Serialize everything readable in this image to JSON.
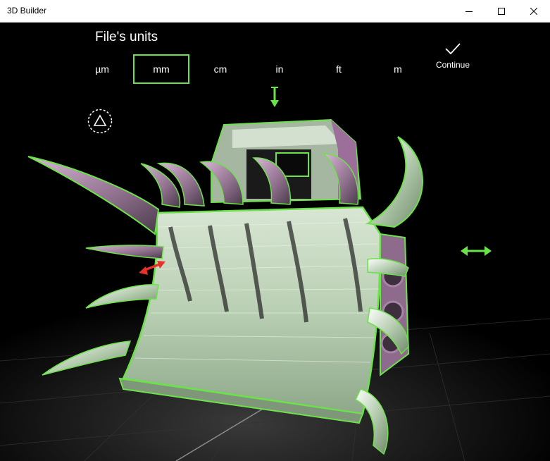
{
  "window": {
    "title": "3D Builder",
    "controls": {
      "minimize": "minimize-icon",
      "maximize": "maximize-icon",
      "close": "close-icon"
    }
  },
  "units_panel": {
    "title": "File's units",
    "options": [
      {
        "label": "µm",
        "selected": false
      },
      {
        "label": "mm",
        "selected": true
      },
      {
        "label": "cm",
        "selected": false
      },
      {
        "label": "in",
        "selected": false
      },
      {
        "label": "ft",
        "selected": false
      },
      {
        "label": "m",
        "selected": false
      }
    ],
    "continue_label": "Continue"
  },
  "colors": {
    "accent_green": "#6ce24a",
    "model_face": "#c9dbc4",
    "spike_purple": "#b98bb5",
    "rotate_handle": "#e5332a",
    "background": "#000000"
  },
  "icons": {
    "continue": "checkmark-icon",
    "view": "view-cube-icon",
    "move_vertical": "arrow-down-icon",
    "move_horizontal": "arrow-left-right-icon",
    "rotate": "rotate-handle-icon"
  }
}
